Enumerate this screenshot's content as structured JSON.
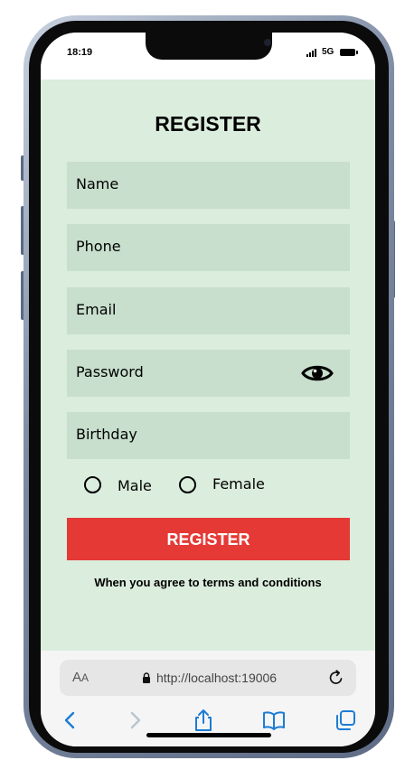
{
  "status_bar": {
    "time": "18:19",
    "network": "5G"
  },
  "form": {
    "title": "REGISTER",
    "fields": [
      {
        "label": "Name"
      },
      {
        "label": "Phone"
      },
      {
        "label": "Email"
      },
      {
        "label": "Password",
        "icon": "eye-icon"
      },
      {
        "label": "Birthday"
      }
    ],
    "gender_options": [
      "Male",
      "Female"
    ],
    "submit_label": "REGISTER",
    "terms_text": "When you agree to terms and conditions"
  },
  "browser": {
    "text_size_label": "AA",
    "url": "http://localhost:19006",
    "icons": [
      "back-icon",
      "forward-icon",
      "share-icon",
      "bookmarks-icon",
      "tabs-icon"
    ]
  },
  "colors": {
    "background": "#dbeddd",
    "field": "#c7dfcc",
    "button": "#e53935",
    "link_blue": "#1c7cd6"
  }
}
